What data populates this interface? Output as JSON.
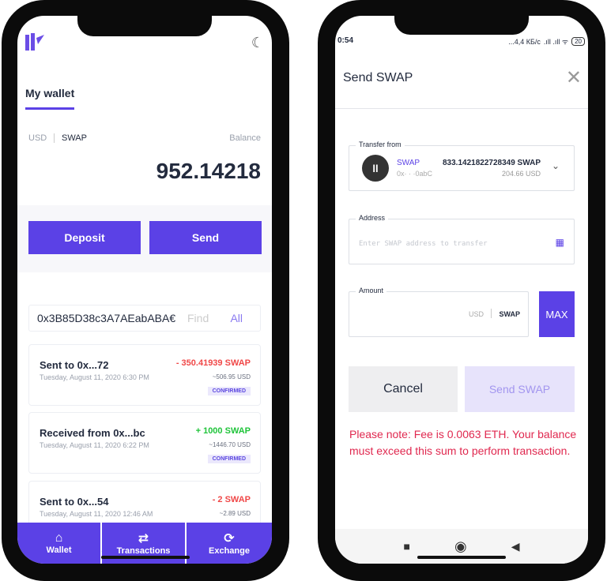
{
  "left": {
    "tab": "My wallet",
    "currency_usd": "USD",
    "currency_swap": "SWAP",
    "balance_label": "Balance",
    "balance": "952.14218",
    "deposit": "Deposit",
    "send": "Send",
    "address": "0x3B85D38c3A7AEabABA€",
    "find_placeholder": "Find",
    "all": "All",
    "transactions": [
      {
        "title": "Sent to 0x...72",
        "date": "Tuesday, August 11, 2020 6:30 PM",
        "amount": "- 350.41939 SWAP",
        "usd": "~506.95 USD",
        "status": "CONFIRMED",
        "color": "#f04848"
      },
      {
        "title": "Received from 0x...bc",
        "date": "Tuesday, August 11, 2020 6:22 PM",
        "amount": "+ 1000 SWAP",
        "usd": "~1446.70 USD",
        "status": "CONFIRMED",
        "color": "#1fc43a"
      },
      {
        "title": "Sent to 0x...54",
        "date": "Tuesday, August 11, 2020 12:46 AM",
        "amount": "- 2 SWAP",
        "usd": "~2.89 USD",
        "color": "#f04848"
      }
    ],
    "nav": [
      "Wallet",
      "Transactions",
      "Exchange"
    ]
  },
  "right": {
    "status_time": "0:54",
    "status_right": "...4,4 КБ/с",
    "battery": "20",
    "title": "Send SWAP",
    "transfer_from_label": "Transfer from",
    "token": "SWAP",
    "token_address": "0x· · ·0abC",
    "token_balance": "833.1421822728349 SWAP",
    "token_usd": "204.66 USD",
    "address_label": "Address",
    "address_placeholder": "Enter SWAP address to transfer",
    "amount_label": "Amount",
    "amount_usd": "USD",
    "amount_swap": "SWAP",
    "max": "MAX",
    "cancel": "Cancel",
    "send": "Send SWAP",
    "note": "Please note: Fee is 0.0063 ETH. Your balance must exceed this sum to perform transaction."
  },
  "colors": {
    "accent": "#5b41e6",
    "error": "#e0284f"
  }
}
